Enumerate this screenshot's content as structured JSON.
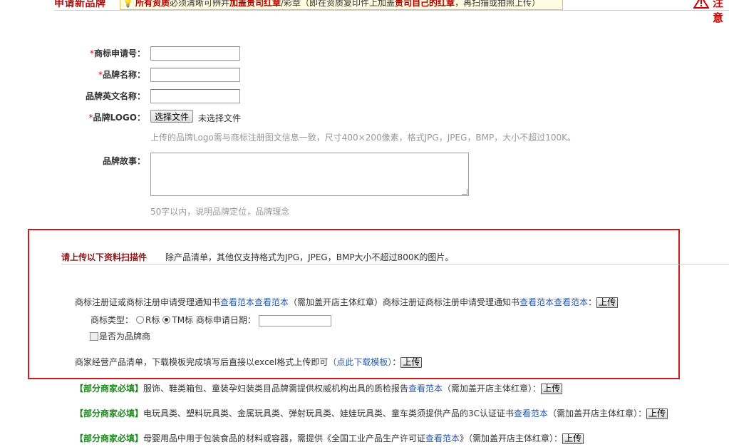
{
  "header": {
    "title": "申请新品牌",
    "notice": {
      "part1": "所有资质",
      "part2": "必须清晰可辨并",
      "part3": "加盖贵司红章",
      "part4": "/彩章（即在资质复印件上加盖",
      "part5": "贵司自己的红章",
      "part6": "，再扫描或拍照上传）"
    },
    "warning_label": "注意"
  },
  "form": {
    "trademark_no_label": "商标申请号：",
    "brand_name_label": "品牌名称：",
    "brand_en_label": "品牌英文名称：",
    "logo_label": "品牌LOGO：",
    "file_button": "选择文件",
    "file_status": "未选择文件",
    "logo_hint": "上传的品牌Logo需与商标注册图文信息一致，尺寸400×200像素，格式JPG，JPEG，BMP，大小不超过100K。",
    "story_label": "品牌故事：",
    "story_hint": "50字以内，说明品牌定位，品牌理念",
    "required_mark": "*"
  },
  "upload_section": {
    "title": "请上传以下资料扫描件",
    "desc": "除产品清单，其他仅支持格式为JPG，JPEG，BMP大小不超过800K的图片。",
    "row1": {
      "text_a": "商标注册证或商标注册申请受理通知书",
      "link_a1": "查看范本",
      "link_a2": "查看范本",
      "text_b": "（需加盖开店主体红章）商标注册证商标注册申请受理通知书",
      "link_b1": "查看范本",
      "link_b2": "查看范本",
      "colon": "：",
      "upload": "上传"
    },
    "trademark_type_label": "商标类型：",
    "r_label": "R标",
    "tm_label": "TM标",
    "apply_date_label": "商标申请日期：",
    "brand_owner_label": "是否为品牌商",
    "row_list": {
      "text": "商家经营产品清单，下载模板完成填写后直接以excel格式上传即可",
      "link": "（点此下载模板）",
      "colon": "：",
      "upload": "上传"
    }
  },
  "extra_rows": [
    {
      "tag": "【部分商家必填】",
      "text": "服饰、鞋类箱包、童装孕妇装类目品牌需提供权威机构出具的质检报告",
      "link": "查看范本",
      "suffix": "（需加盖开店主体红章）：",
      "upload": "上传"
    },
    {
      "tag": "【部分商家必填】",
      "text": "电玩具类、塑料玩具类、金属玩具类、弹射玩具类、娃娃玩具类、童车类须提供产品的3C认证证书",
      "link": "查看范本",
      "suffix": "（需加盖开店主体红章）：",
      "upload": "上传"
    },
    {
      "tag": "【部分商家必填】",
      "text": "母婴用品中用于包装食品的材料或容器，需提供《全国工业产品生产许可证",
      "link": "查看范本",
      "suffix": "》（需加盖开店主体红章）：",
      "upload": "上传"
    }
  ],
  "colors": {
    "accent_red": "#cc1a1a",
    "link_blue": "#2a5aa8",
    "tag_green": "#1c8a1c"
  }
}
